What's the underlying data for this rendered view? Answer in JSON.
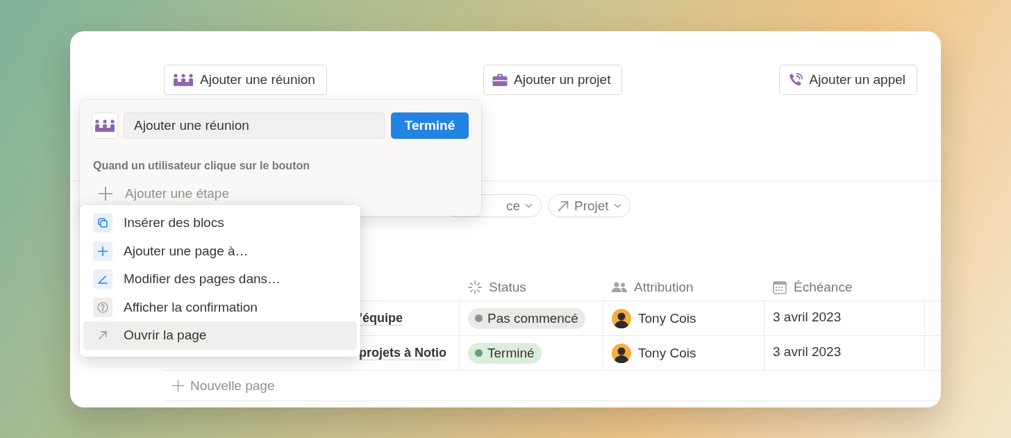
{
  "action_buttons": [
    {
      "label": "Ajouter une réunion",
      "kind": "meeting"
    },
    {
      "label": "Ajouter un projet",
      "kind": "briefcase"
    },
    {
      "label": "Ajouter un appel",
      "kind": "phone"
    }
  ],
  "button_editor": {
    "name_value": "Ajouter une réunion",
    "done_button": "Terminé",
    "trigger_label": "Quand un utilisateur clique sur le bouton",
    "add_step": "Ajouter une étape"
  },
  "step_menu": {
    "items": [
      {
        "label": "Insérer des blocs",
        "kind": "copy",
        "selected": false
      },
      {
        "label": "Ajouter une page à…",
        "kind": "plus",
        "selected": false
      },
      {
        "label": "Modifier des pages dans…",
        "kind": "edit",
        "selected": false
      },
      {
        "label": "Afficher la confirmation",
        "kind": "question",
        "selected": false
      },
      {
        "label": "Ouvrir la page",
        "kind": "arrow",
        "selected": true
      }
    ]
  },
  "filters": [
    {
      "label": "ce",
      "kind": "plain"
    },
    {
      "label": "Projet",
      "kind": "relation"
    }
  ],
  "table": {
    "columns": [
      {
        "label": "Status",
        "kind": "status"
      },
      {
        "label": "Attribution",
        "kind": "person"
      },
      {
        "label": "Échéance",
        "kind": "date"
      }
    ],
    "rows": [
      {
        "name": "’équipe",
        "status": {
          "label": "Pas commencé",
          "color": "#91918e"
        },
        "assignee": "Tony Cois",
        "due": "3 avril 2023"
      },
      {
        "name": "projets à Notio",
        "status": {
          "label": "Terminé",
          "color": "#6c9b7d"
        },
        "assignee": "Tony Cois",
        "due": "3 avril 2023"
      }
    ],
    "new_row": "Nouvelle page"
  }
}
